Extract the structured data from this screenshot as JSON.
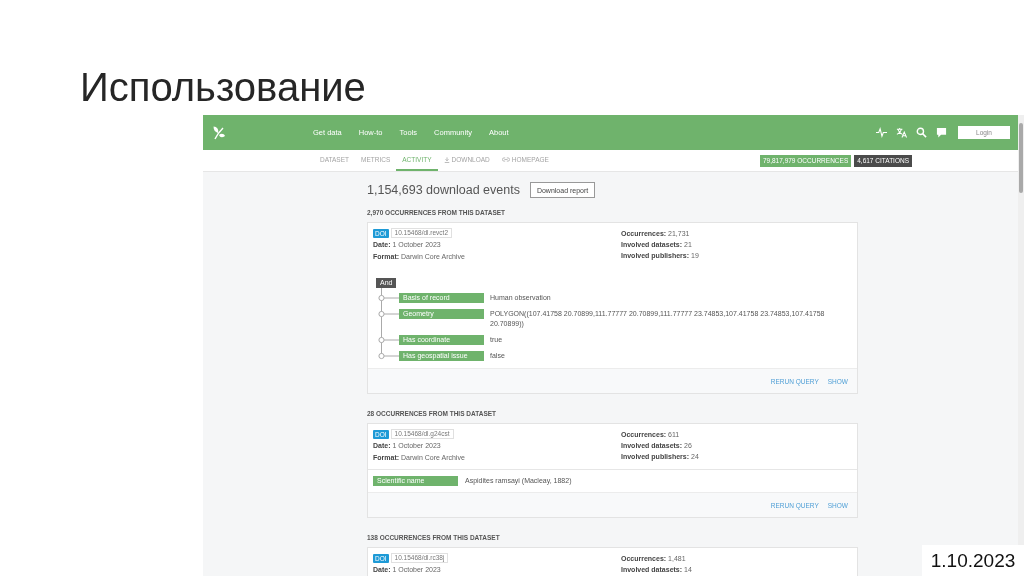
{
  "slide": {
    "title": "Использование",
    "date": "1.10.2023"
  },
  "navbar": {
    "links": [
      "Get data",
      "How-to",
      "Tools",
      "Community",
      "About"
    ],
    "login": "Login"
  },
  "subnav": {
    "tabs": [
      {
        "label": "DATASET",
        "kind": "page",
        "selected": false
      },
      {
        "label": "METRICS",
        "kind": "page",
        "selected": false
      },
      {
        "label": "ACTIVITY",
        "kind": "page",
        "selected": true
      },
      {
        "label": "DOWNLOAD",
        "kind": "download",
        "selected": false
      },
      {
        "label": "HOMEPAGE",
        "kind": "link",
        "selected": false
      }
    ],
    "counts": [
      {
        "kind": "occurrences",
        "label": "79,817,979 OCCURRENCES"
      },
      {
        "kind": "citations",
        "label": "4,617 CITATIONS"
      }
    ]
  },
  "activity": {
    "headline": "1,154,693 download events",
    "report_button": "Download report",
    "downloads": [
      {
        "heading": "2,970 OCCURRENCES FROM THIS DATASET",
        "doi_badge": "DOI",
        "doi": "10.15468/dl.revct2",
        "details": [
          "**Date:** 1 October 2023",
          "**Format:** Darwin Core Archive"
        ],
        "stats": [
          "**Occurrences:** 21,731",
          "**Involved datasets:** 21",
          "**Involved publishers:** 19"
        ],
        "filter": {
          "operator": "And",
          "predicates": [
            {
              "name": "Basis of record",
              "value": "Human observation"
            },
            {
              "name": "Geometry",
              "value": "POLYGON((107.41758 20.70899,111.77777 20.70899,111.77777 23.74853,107.41758 23.74853,107.41758 20.70899))"
            },
            {
              "name": "Has coordinate",
              "value": "true"
            },
            {
              "name": "Has geospatial issue",
              "value": "false"
            }
          ]
        },
        "actions": [
          "RERUN QUERY",
          "SHOW"
        ]
      },
      {
        "heading": "28 OCCURRENCES FROM THIS DATASET",
        "doi_badge": "DOI",
        "doi": "10.15468/dl.g24cst",
        "details": [
          "**Date:** 1 October 2023",
          "**Format:** Darwin Core Archive"
        ],
        "stats": [
          "**Occurrences:** 611",
          "**Involved datasets:** 26",
          "**Involved publishers:** 24"
        ],
        "filter": {
          "predicates": [
            {
              "name": "Scientific name",
              "value": "Aspidites ramsayi (Macleay, 1882)"
            }
          ]
        },
        "actions": [
          "RERUN QUERY",
          "SHOW"
        ]
      },
      {
        "heading": "138 OCCURRENCES FROM THIS DATASET",
        "doi_badge": "DOI",
        "doi": "10.15468/dl.rc38j",
        "details": [
          "**Date:** 1 October 2023"
        ],
        "stats": [
          "**Occurrences:** 1,481",
          "**Involved datasets:** 14"
        ]
      }
    ]
  }
}
